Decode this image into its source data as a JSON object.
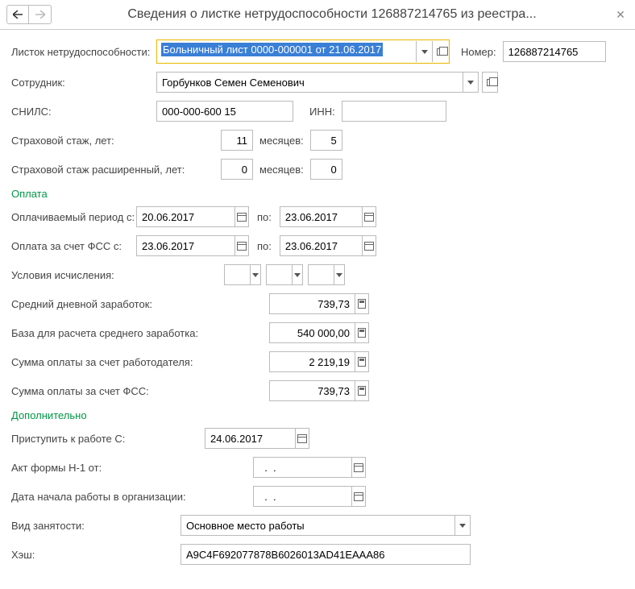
{
  "title": "Сведения о листке нетрудоспособности 126887214765 из реестра...",
  "labels": {
    "sickleave": "Листок нетрудоспособности:",
    "number": "Номер:",
    "employee": "Сотрудник:",
    "snils": "СНИЛС:",
    "inn": "ИНН:",
    "ins_years": "Страховой стаж, лет:",
    "months": "месяцев:",
    "ins_ext_years": "Страховой стаж расширенный, лет:",
    "payment": "Оплата",
    "paid_from": "Оплачиваемый период с:",
    "to": "по:",
    "fss_from": "Оплата за счет ФСС с:",
    "calc_cond": "Условия исчисления:",
    "avg_daily": "Средний дневной заработок:",
    "base_avg": "База для расчета среднего заработка:",
    "employer_sum": "Сумма оплаты за счет работодателя:",
    "fss_sum": "Сумма оплаты за счет ФСС:",
    "additional": "Дополнительно",
    "back_to_work": "Приступить к работе С:",
    "act_h1": "Акт формы Н-1 от:",
    "org_start": "Дата начала работы в организации:",
    "emp_type": "Вид занятости:",
    "hash": "Хэш:"
  },
  "values": {
    "sickleave": "Больничный лист 0000-000001 от 21.06.2017",
    "number": "126887214765",
    "employee": "Горбунков Семен Семенович",
    "snils": "000-000-600 15",
    "inn": "",
    "ins_years": "11",
    "ins_months": "5",
    "ins_ext_years": "0",
    "ins_ext_months": "0",
    "paid_from": "20.06.2017",
    "paid_to": "23.06.2017",
    "fss_from": "23.06.2017",
    "fss_to": "23.06.2017",
    "avg_daily": "739,73",
    "base_avg": "540 000,00",
    "employer_sum": "2 219,19",
    "fss_sum": "739,73",
    "back_to_work": "24.06.2017",
    "act_h1": "  .  .    ",
    "org_start": "  .  .    ",
    "emp_type": "Основное место работы",
    "hash": "A9C4F692077878B6026013AD41EAAA86"
  }
}
